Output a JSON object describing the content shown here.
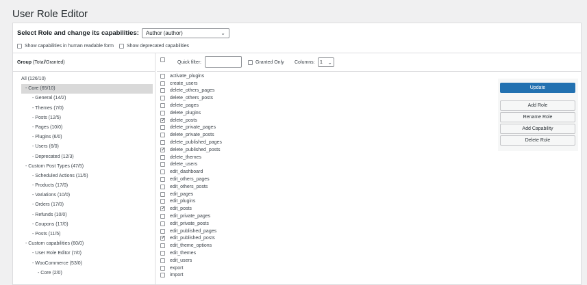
{
  "page": {
    "title": "User Role Editor"
  },
  "role_select": {
    "label": "Select Role and change its capabilities:",
    "value": "Author (author)"
  },
  "options": {
    "human_readable": "Show capabilities in human readable form",
    "deprecated": "Show deprecated capabilities"
  },
  "group_header": {
    "bold": "Group",
    "rest": " (Total/Granted)"
  },
  "groups": [
    {
      "label": "All (126/10)",
      "indent": 0,
      "selected": false
    },
    {
      "label": "- Core (65/10)",
      "indent": 1,
      "selected": true
    },
    {
      "label": "- General (14/2)",
      "indent": 2,
      "selected": false
    },
    {
      "label": "- Themes (7/0)",
      "indent": 2,
      "selected": false
    },
    {
      "label": "- Posts (12/5)",
      "indent": 2,
      "selected": false
    },
    {
      "label": "- Pages (10/0)",
      "indent": 2,
      "selected": false
    },
    {
      "label": "- Plugins (6/0)",
      "indent": 2,
      "selected": false
    },
    {
      "label": "- Users (6/0)",
      "indent": 2,
      "selected": false
    },
    {
      "label": "- Deprecated (12/3)",
      "indent": 2,
      "selected": false
    },
    {
      "label": "- Custom Post Types (47/5)",
      "indent": 1,
      "selected": false
    },
    {
      "label": "- Scheduled Actions (11/5)",
      "indent": 2,
      "selected": false
    },
    {
      "label": "- Products (17/0)",
      "indent": 2,
      "selected": false
    },
    {
      "label": "- Variations (10/0)",
      "indent": 2,
      "selected": false
    },
    {
      "label": "- Orders (17/0)",
      "indent": 2,
      "selected": false
    },
    {
      "label": "- Refunds (10/0)",
      "indent": 2,
      "selected": false
    },
    {
      "label": "- Coupons (17/0)",
      "indent": 2,
      "selected": false
    },
    {
      "label": "- Posts (11/5)",
      "indent": 2,
      "selected": false
    },
    {
      "label": "- Custom capabilities (60/0)",
      "indent": 1,
      "selected": false
    },
    {
      "label": "- User Role Editor (7/0)",
      "indent": 2,
      "selected": false
    },
    {
      "label": "- WooCommerce (53/0)",
      "indent": 2,
      "selected": false
    },
    {
      "label": "- Core (2/0)",
      "indent": 3,
      "selected": false
    }
  ],
  "toolbar": {
    "quick_filter_label": "Quick filter:",
    "granted_only": "Granted Only",
    "columns_label": "Columns:",
    "columns_value": "1"
  },
  "capabilities": [
    {
      "name": "activate_plugins",
      "checked": false
    },
    {
      "name": "create_users",
      "checked": false
    },
    {
      "name": "delete_others_pages",
      "checked": false
    },
    {
      "name": "delete_others_posts",
      "checked": false
    },
    {
      "name": "delete_pages",
      "checked": false
    },
    {
      "name": "delete_plugins",
      "checked": false
    },
    {
      "name": "delete_posts",
      "checked": true
    },
    {
      "name": "delete_private_pages",
      "checked": false
    },
    {
      "name": "delete_private_posts",
      "checked": false
    },
    {
      "name": "delete_published_pages",
      "checked": false
    },
    {
      "name": "delete_published_posts",
      "checked": true
    },
    {
      "name": "delete_themes",
      "checked": false
    },
    {
      "name": "delete_users",
      "checked": false
    },
    {
      "name": "edit_dashboard",
      "checked": false
    },
    {
      "name": "edit_others_pages",
      "checked": false
    },
    {
      "name": "edit_others_posts",
      "checked": false
    },
    {
      "name": "edit_pages",
      "checked": false
    },
    {
      "name": "edit_plugins",
      "checked": false
    },
    {
      "name": "edit_posts",
      "checked": true
    },
    {
      "name": "edit_private_pages",
      "checked": false
    },
    {
      "name": "edit_private_posts",
      "checked": false
    },
    {
      "name": "edit_published_pages",
      "checked": false
    },
    {
      "name": "edit_published_posts",
      "checked": true
    },
    {
      "name": "edit_theme_options",
      "checked": false
    },
    {
      "name": "edit_themes",
      "checked": false
    },
    {
      "name": "edit_users",
      "checked": false
    },
    {
      "name": "export",
      "checked": false
    },
    {
      "name": "import",
      "checked": false
    }
  ],
  "actions": {
    "update": "Update",
    "add_role": "Add Role",
    "rename_role": "Rename Role",
    "add_capability": "Add Capability",
    "delete_role": "Delete Role"
  },
  "colors": {
    "primary": "#2271b1",
    "selected_group": "#d9d9d9"
  }
}
